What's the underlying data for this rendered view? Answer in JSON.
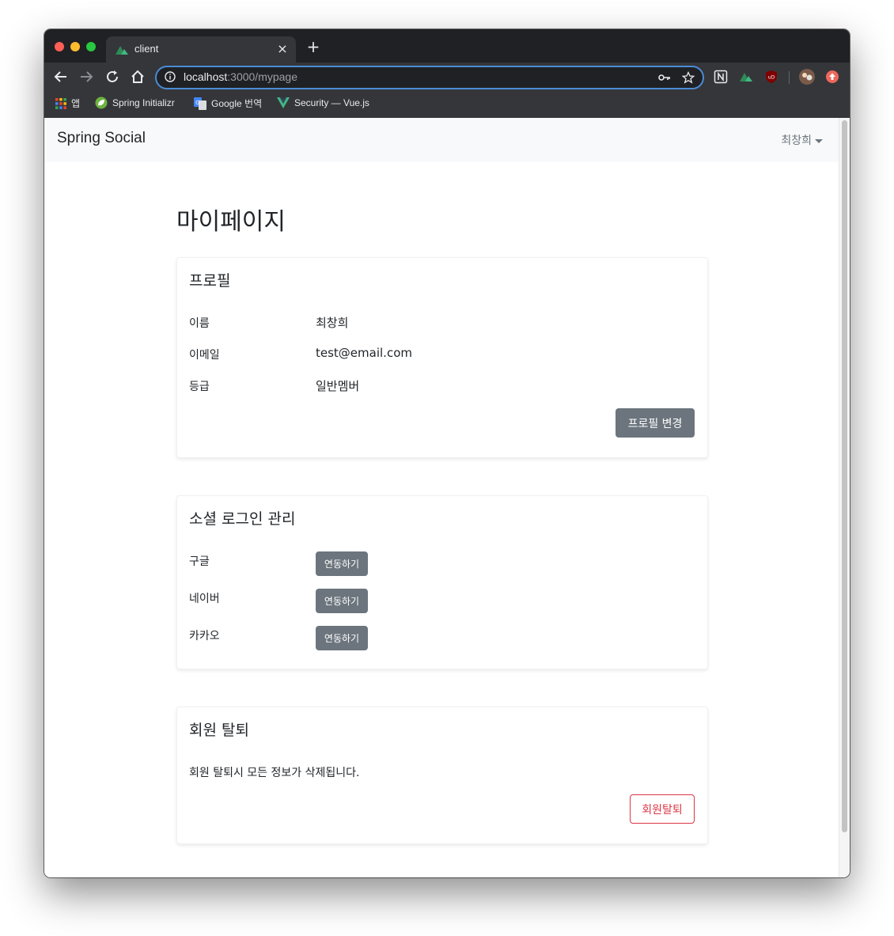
{
  "browser": {
    "tab_title": "client",
    "tab_close": "×",
    "new_tab": "+",
    "url_host": "localhost",
    "url_path": ":3000/mypage",
    "bookmarks": [
      {
        "label": "앱",
        "icon": "apps-grid-icon"
      },
      {
        "label": "Spring Initializr",
        "icon": "spring-leaf-icon"
      },
      {
        "label": "Google 번역",
        "icon": "google-translate-icon"
      },
      {
        "label": "Security — Vue.js",
        "icon": "vue-logo-icon"
      }
    ],
    "colors": {
      "tab_bg": "#35363a",
      "frame_bg": "#202124",
      "accent": "#4a8cd6"
    }
  },
  "navbar": {
    "brand": "Spring Social",
    "user_name": "최창희"
  },
  "page": {
    "title": "마이페이지"
  },
  "profile": {
    "title": "프로필",
    "rows": [
      {
        "label": "이름",
        "value": "최창희"
      },
      {
        "label": "이메일",
        "value": "test@email.com"
      },
      {
        "label": "등급",
        "value": "일반멤버"
      }
    ],
    "edit_button": "프로필 변경"
  },
  "social": {
    "title": "소셜 로그인 관리",
    "rows": [
      {
        "label": "구글",
        "button": "연동하기"
      },
      {
        "label": "네이버",
        "button": "연동하기"
      },
      {
        "label": "카카오",
        "button": "연동하기"
      }
    ]
  },
  "withdraw": {
    "title": "회원 탈퇴",
    "description": "회원 탈퇴시 모든 정보가 삭제됩니다.",
    "button": "회원탈퇴"
  },
  "theme": {
    "secondary": "#6c757d",
    "danger": "#dc3545",
    "navbar_bg": "#f8f9fa"
  }
}
